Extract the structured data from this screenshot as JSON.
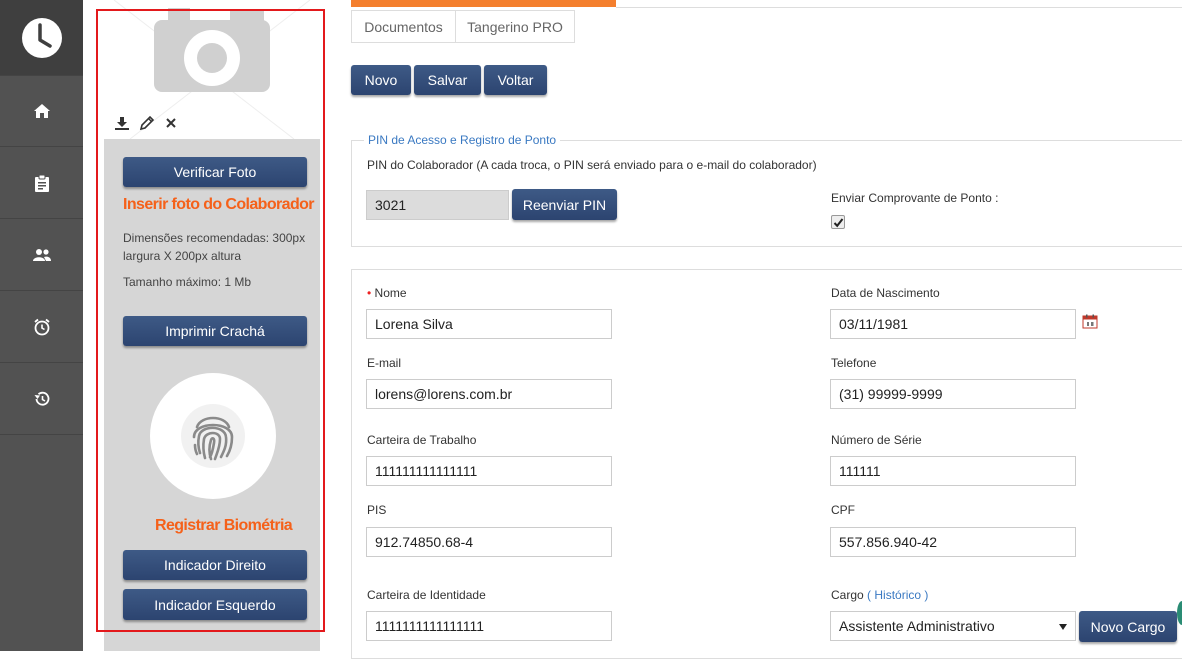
{
  "nav": {
    "items": [
      "clock-logo",
      "home-icon",
      "clipboard-icon",
      "users-icon",
      "alarm-icon",
      "history-icon"
    ]
  },
  "photo": {
    "verify_label": "Verificar Foto",
    "insert_title": "Inserir foto do Colaborador",
    "dimensions_text": "Dimensões recomendadas: 300px largura X 200px altura",
    "max_size_text": "Tamanho máximo: 1 Mb",
    "print_badge_label": "Imprimir Crachá",
    "biometry_title": "Registrar Biométria",
    "right_finger_label": "Indicador Direito",
    "left_finger_label": "Indicador Esquerdo"
  },
  "tabs": {
    "documents": "Documentos",
    "tangerino_pro": "Tangerino PRO"
  },
  "toolbar": {
    "new_label": "Novo",
    "save_label": "Salvar",
    "back_label": "Voltar"
  },
  "pin_section": {
    "legend": "PIN de Acesso e Registro de Ponto",
    "description": "PIN do Colaborador (A cada troca, o PIN será enviado para o e-mail do colaborador)",
    "pin_value": "3021",
    "resend_label": "Reenviar PIN",
    "send_receipt_label": "Enviar Comprovante de Ponto :",
    "send_receipt_checked": true
  },
  "form": {
    "name_label": "Nome",
    "name_value": "Lorena Silva",
    "birth_label": "Data de Nascimento",
    "birth_value": "03/11/1981",
    "email_label": "E-mail",
    "email_value": "lorens@lorens.com.br",
    "phone_label": "Telefone",
    "phone_value": "(31) 99999-9999",
    "work_card_label": "Carteira de Trabalho",
    "work_card_value": "111111111111111",
    "serial_label": "Número de Série",
    "serial_value": "111111",
    "pis_label": "PIS",
    "pis_value": "912.74850.68-4",
    "cpf_label": "CPF",
    "cpf_value": "557.856.940-42",
    "id_card_label": "Carteira de Identidade",
    "id_card_value": "1111111111111111",
    "role_label": "Cargo",
    "role_history_link": "( Histórico )",
    "role_value": "Assistente Administrativo",
    "new_role_label": "Novo Cargo"
  },
  "colors": {
    "accent": "#2f4a78",
    "orange": "#f5611a",
    "link": "#3a79c2",
    "highlight_frame": "#e3191c"
  }
}
